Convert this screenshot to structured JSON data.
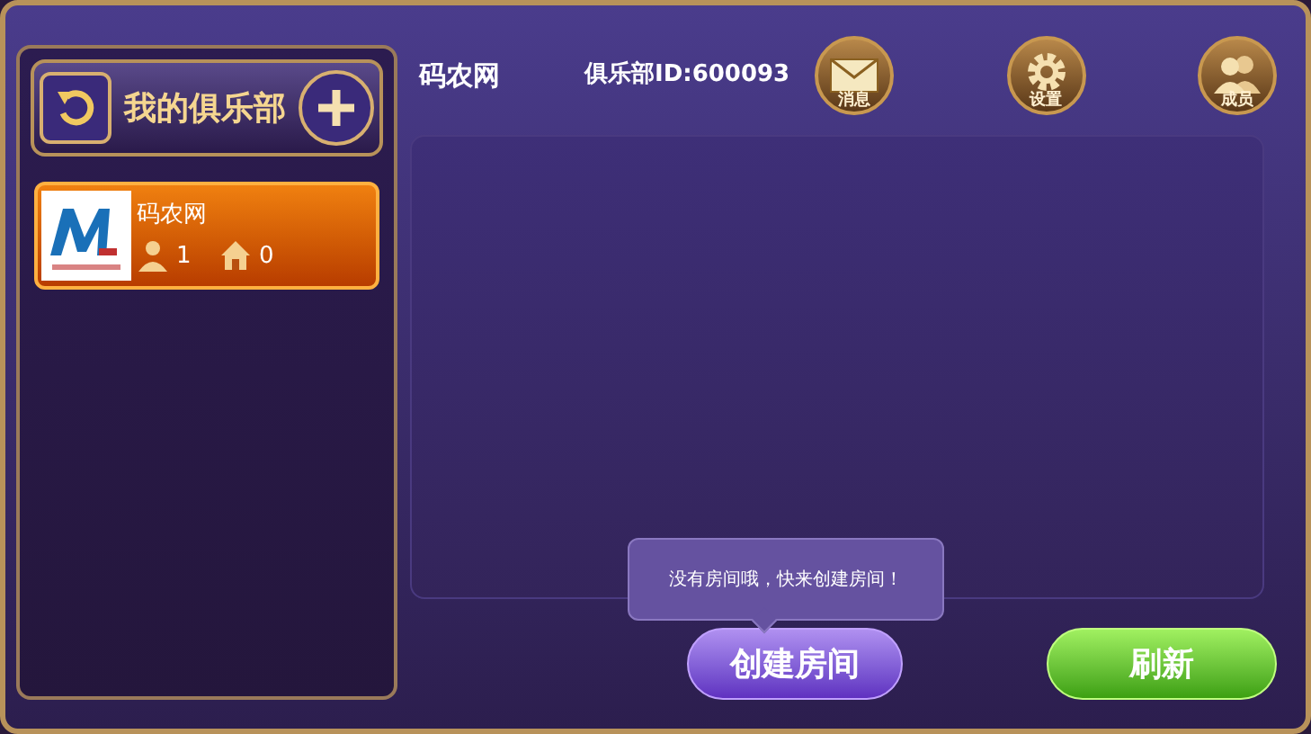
{
  "sidebar": {
    "title": "我的俱乐部",
    "clubs": [
      {
        "name": "码农网",
        "members": "1",
        "rooms": "0",
        "selected": true
      }
    ]
  },
  "header": {
    "club_name": "码农网",
    "club_id": "俱乐部ID:600093",
    "actions": [
      {
        "kind": "mail",
        "label": "消息"
      },
      {
        "kind": "gear",
        "label": "设置"
      },
      {
        "kind": "people",
        "label": "成员"
      }
    ]
  },
  "tooltip": "没有房间哦，快来创建房间！",
  "buttons": [
    {
      "kind": "create",
      "label": "创建房间"
    },
    {
      "kind": "refresh",
      "label": "刷新"
    }
  ]
}
